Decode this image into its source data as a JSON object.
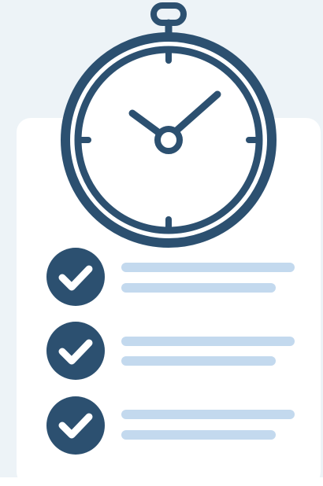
{
  "colors": {
    "background": "#EDF3F7",
    "card": "#FFFFFF",
    "primary": "#2C5070",
    "accent_lines": "#C3D9EE",
    "check_mark": "#FFFFFF"
  },
  "illustration": {
    "icon": "stopwatch-checklist-icon",
    "stopwatch": {
      "icon": "stopwatch-icon",
      "hands": "clock-hands-icon"
    },
    "checklist": {
      "items": [
        {
          "icon": "check-circle-icon",
          "checked": true
        },
        {
          "icon": "check-circle-icon",
          "checked": true
        },
        {
          "icon": "check-circle-icon",
          "checked": true
        }
      ]
    }
  }
}
